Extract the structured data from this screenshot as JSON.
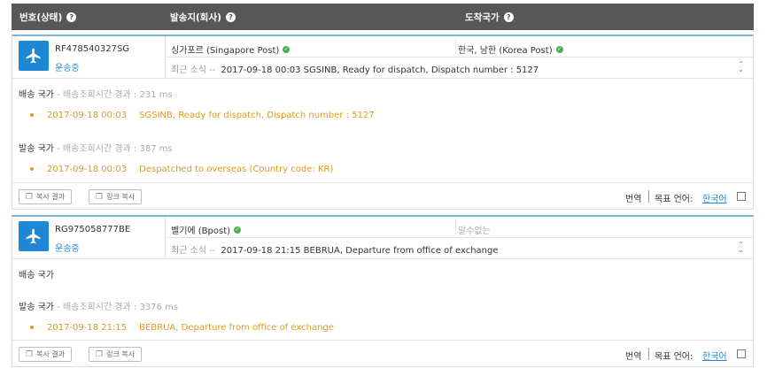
{
  "header": {
    "col1": "번호(상태)",
    "col2": "발송지(회사)",
    "col3": "도착국가",
    "help_glyph": "?"
  },
  "colors": {
    "accent": "#1f88d6",
    "event": "#e09a1d",
    "header_bg": "#575757",
    "ok": "#4caf50"
  },
  "cards": [
    {
      "tracking": "RF478540327SG",
      "status": "운송중",
      "from": "싱가포르 (Singapore Post)",
      "to": "한국, 남한 (Korea Post)",
      "latest_label": "최근 소식 --",
      "latest": "2017-09-18 00:03 SGSINB, Ready for dispatch, Dispatch number : 5127",
      "sections": [
        {
          "title": "배송 국가",
          "sub": " - 배송조회시간 경과 : 231 ms",
          "events": [
            {
              "time": "2017-09-18 00:03",
              "text": "SGSINB, Ready for dispatch, Dispatch number : 5127"
            }
          ]
        },
        {
          "title": "발송 국가",
          "sub": " - 배송조회시간 경과 : 387 ms",
          "events": [
            {
              "time": "2017-09-18 00:03",
              "text": "Despatched to overseas (Country code: KR)"
            }
          ]
        }
      ]
    },
    {
      "tracking": "RG975058777BE",
      "status": "운송중",
      "from": "벨기에 (Bpost)",
      "to": "알수없는",
      "latest_label": "최근 소식 --",
      "latest": "2017-09-18 21:15 BEBRUA, Departure from office of exchange",
      "sections": [
        {
          "title": "배송 국가",
          "sub": "",
          "events": []
        },
        {
          "title": "발송 국가",
          "sub": " - 배송조회시간 경과 : 3376 ms",
          "events": [
            {
              "time": "2017-09-18 21:15",
              "text": "BEBRUA, Departure from office of exchange"
            }
          ]
        }
      ]
    }
  ],
  "footer": {
    "copy_result": "복사 결과",
    "copy_link": "링크 복사",
    "translate": "번역",
    "target_lang_label": "목표 언어:",
    "target_lang": "한국어"
  },
  "icons": {
    "plane": "airplane-icon",
    "help": "help-icon",
    "check": "check-icon",
    "copy": "copy-icon",
    "sort": "sort-arrows-icon"
  }
}
